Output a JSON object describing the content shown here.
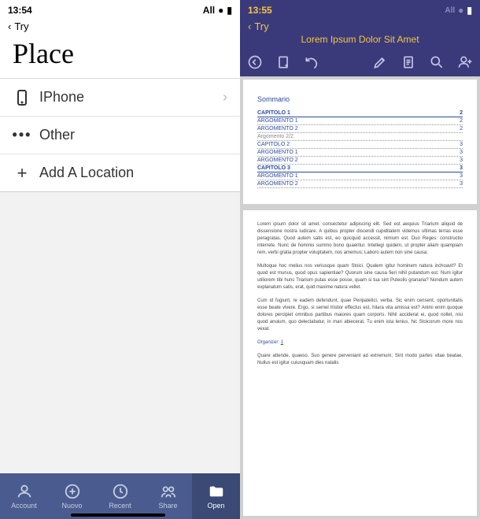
{
  "left": {
    "status": {
      "time": "13:54",
      "signal": "All",
      "wifi": "●",
      "battery": "■"
    },
    "back_label": "Try",
    "title": "Place",
    "rows": [
      {
        "icon": "phone",
        "label": "IPhone",
        "chevron": true
      },
      {
        "icon": "dots",
        "label": "Other",
        "chevron": false
      },
      {
        "icon": "plus",
        "label": "Add A Location",
        "chevron": false
      }
    ],
    "tabs": [
      {
        "icon": "account",
        "label": "Account"
      },
      {
        "icon": "new",
        "label": "Nuovo"
      },
      {
        "icon": "recent",
        "label": "Recent"
      },
      {
        "icon": "share",
        "label": "Share"
      },
      {
        "icon": "open",
        "label": "Open",
        "active": true
      }
    ]
  },
  "right": {
    "status": {
      "time": "13:55",
      "signal": "All",
      "wifi": "●",
      "battery": "■"
    },
    "back_label": "Try",
    "doc_title": "Lorem Ipsum Dolor Sit Amet",
    "toolbar": [
      "back-circle",
      "new-doc",
      "undo",
      "pen",
      "page",
      "search",
      "person-add"
    ],
    "summary_heading": "Sommario",
    "toc": [
      {
        "label": "CAPITOLO 1",
        "page": "2",
        "type": "chap"
      },
      {
        "label": "ARGOMENTO 1",
        "page": "2",
        "type": "sub"
      },
      {
        "label": "ARGOMENTO 2",
        "page": "2",
        "type": "sub"
      },
      {
        "label": "Argomento 2/2",
        "page": "",
        "type": "grey"
      },
      {
        "label": "CAPITOLO 2",
        "page": "3",
        "type": "sub"
      },
      {
        "label": "ARGOMENTO 1",
        "page": "3",
        "type": "sub"
      },
      {
        "label": "ARGOMENTO 2",
        "page": "3",
        "type": "sub"
      },
      {
        "label": "CAPITOLO 3",
        "page": "3",
        "type": "chap"
      },
      {
        "label": "ARGOMENTO 1",
        "page": "3",
        "type": "sub"
      },
      {
        "label": "ARGOMENTO 2",
        "page": "3",
        "type": "sub"
      }
    ],
    "body": {
      "p1": "Lorem ipsum dolor sit amet, consectetur adipiscing elit. Sed est aequius Triarium aliquid de dissensione nostra iudicare. A quibus propter discendi cupiditatem videmus ultimas terras esse peragratas. Quod autem satis est, eo quicquid accessit, nimium est. Duo Reges: constructio interrete. Nunc de hominis summo bono quaeritur. Intellegi quidem, ut propter aliam quampiam rem, verbi gratia propter voluptatem, nos amemus; Laboro autem non sine causa;",
      "p2": "Multoque hoc melius nos veriusque quam Stoici. Qualem igitur hominem natura inchoavit? Et quod est munus, quod opus sapientiae? Quorum sine causa fieri nihil putandum est. Num igitur utiliorem tibi hunc Triarium putas esse posse, quam si tua sint Puteolis granaria? Nondum autem explanatum satis, erat, quid maxime natura vellet.",
      "p3": "Cum id fugiunt, re eadem defendunt, quae Peripatetici, verba. Sic enim censent, oportunitatis esse beate vivere. Ergo, si semel tristior effectus est, hilara vita amissa est? Animi enim quoque dolores percipiet omnibus partibus maiores quam corporis. Nihil acciderat ei, quod nollet, nisi quod anulum, quo delectabatur, in mari abiecerat. Tu enim ista lenius, hic Stoicorum more nos vexat.",
      "p4_label": "Organizer:",
      "p4_value": "1",
      "p5": "Quare attende, quaeso. Suo genere perveniant ad extremum; Sint modo partes vitae beatae. Nullus est igitur cuiusquam dies natalis"
    }
  }
}
